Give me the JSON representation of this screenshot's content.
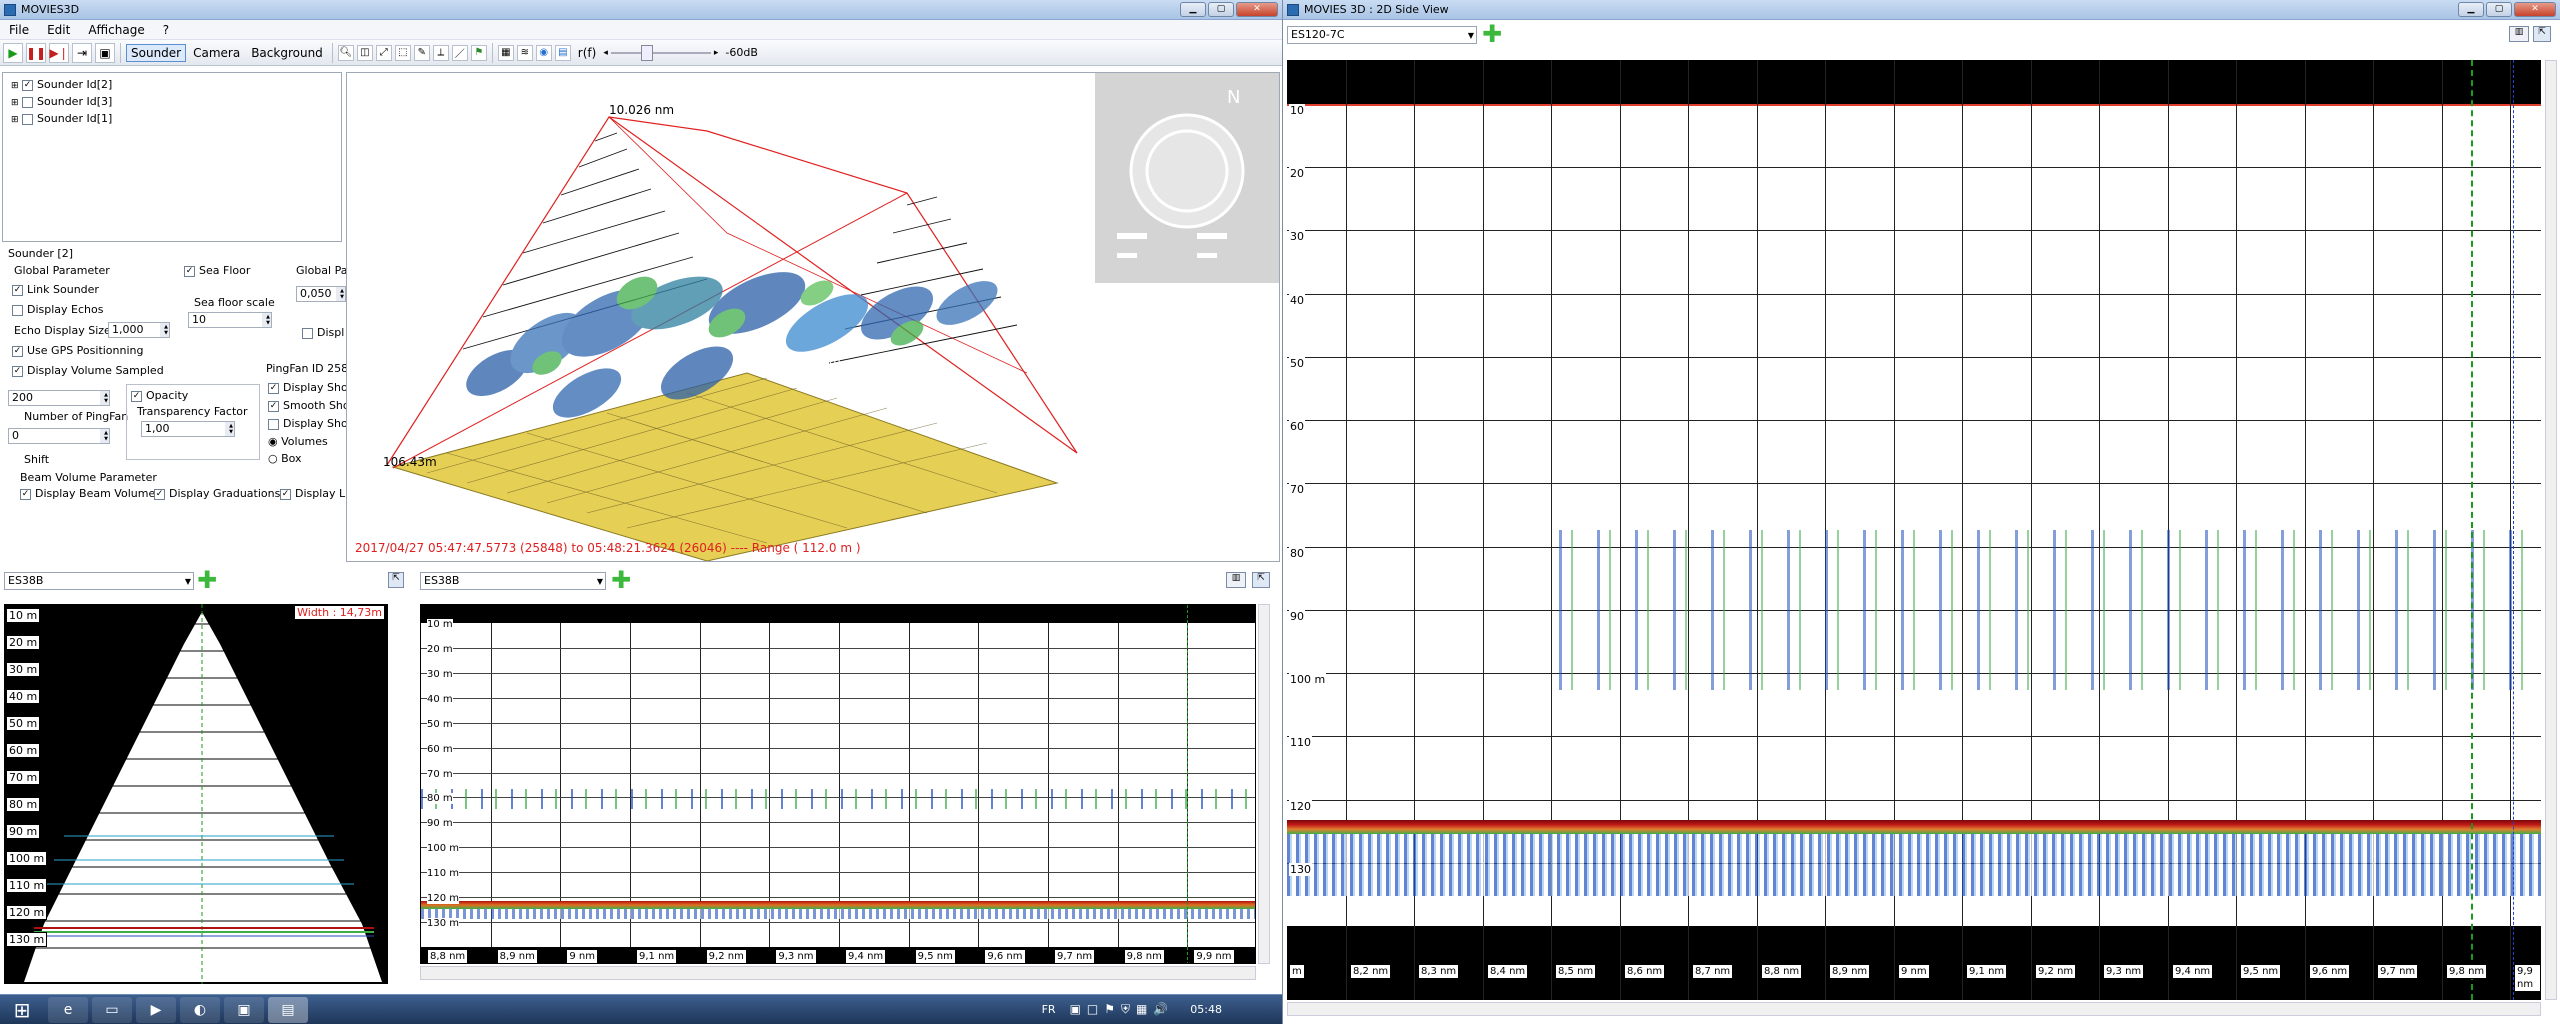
{
  "main_window": {
    "title": "MOVIES3D",
    "menu": [
      "File",
      "Edit",
      "Affichage",
      "?"
    ],
    "toolbar": {
      "tabs": [
        "Sounder",
        "Camera",
        "Background"
      ],
      "threshold_label": "-60dB",
      "rf_label": "r(f)"
    },
    "tree": [
      "Sounder Id[2]",
      "Sounder Id[3]",
      "Sounder Id[1]"
    ],
    "settings": {
      "section_title": "Sounder [2]",
      "global_parameter": "Global Parameter",
      "link_sounder": "Link Sounder",
      "display_echos": "Display Echos",
      "echo_display_size_label": "Echo Display Size",
      "echo_display_size_value": "1,000",
      "use_gps": "Use GPS Positionning",
      "display_volume_sampled": "Display Volume Sampled",
      "pingfan_count_value": "200",
      "number_of_pingfan": "Number of PingFan",
      "shift_value": "0",
      "shift_label": "Shift",
      "sea_floor": "Sea Floor",
      "sea_floor_scale_label": "Sea floor scale",
      "sea_floor_scale_value": "10",
      "global_pa": "Global Pa",
      "global_pa_value": "0,050",
      "displ": "Displ",
      "pingfan_id": "PingFan ID 258",
      "display_sho_1": "Display Sho",
      "smooth_sho": "Smooth Sho",
      "display_sho_2": "Display Sho",
      "volumes": "Volumes",
      "box": "Box",
      "opacity": "Opacity",
      "transparency_factor": "Transparency Factor",
      "transparency_value": "1,00",
      "beam_volume_parameter": "Beam Volume Parameter",
      "display_beam_volume": "Display Beam Volume",
      "display_graduations": "Display Graduations",
      "display_l": "Display L"
    },
    "view3d": {
      "top_label": "10.026 nm",
      "left_label": "106.43m",
      "center_label": "106.43m",
      "status": "2017/04/27 05:47:47.5773 (25848) to 05:48:21.3624 (26046) ---- Range ( 112.0 m )"
    },
    "front_view": {
      "transducer": "ES38B",
      "width_label": "Width : 14,73m",
      "depth_labels": [
        "10 m",
        "20 m",
        "30 m",
        "40 m",
        "50 m",
        "60 m",
        "70 m",
        "80 m",
        "90 m",
        "100 m",
        "110 m",
        "120 m",
        "130 m"
      ]
    },
    "side_view_small": {
      "transducer": "ES38B",
      "depth_labels": [
        "10 m",
        "20 m",
        "30 m",
        "40 m",
        "50 m",
        "60 m",
        "70 m",
        "80 m",
        "90 m",
        "100 m",
        "110 m",
        "120 m",
        "130 m"
      ],
      "distance_labels": [
        "8,8 nm",
        "8,9 nm",
        "9 nm",
        "9,1 nm",
        "9,2 nm",
        "9,3 nm",
        "9,4 nm",
        "9,5 nm",
        "9,6 nm",
        "9,7 nm",
        "9,8 nm",
        "9,9 nm"
      ]
    }
  },
  "side_window": {
    "title": "MOVIES 3D : 2D Side View",
    "transducer": "ES120-7C",
    "depth_labels": [
      "10",
      "20",
      "30",
      "40",
      "50",
      "60",
      "70",
      "80",
      "90",
      "100 m",
      "110",
      "120",
      "130"
    ],
    "distance_labels": [
      "m",
      "8,2 nm",
      "8,3 nm",
      "8,4 nm",
      "8,5 nm",
      "8,6 nm",
      "8,7 nm",
      "8,8 nm",
      "8,9 nm",
      "9 nm",
      "9,1 nm",
      "9,2 nm",
      "9,3 nm",
      "9,4 nm",
      "9,5 nm",
      "9,6 nm",
      "9,7 nm",
      "9,8 nm",
      "9,9 nm"
    ]
  },
  "taskbar": {
    "lang": "FR",
    "clock": "05:48"
  },
  "colors": {
    "echo_blue": "#1f4fbf",
    "echo_green": "#3fae4a",
    "seabed_red": "#b01010",
    "seafloor_yellow": "#e8d25a",
    "range_red": "#e02020"
  }
}
